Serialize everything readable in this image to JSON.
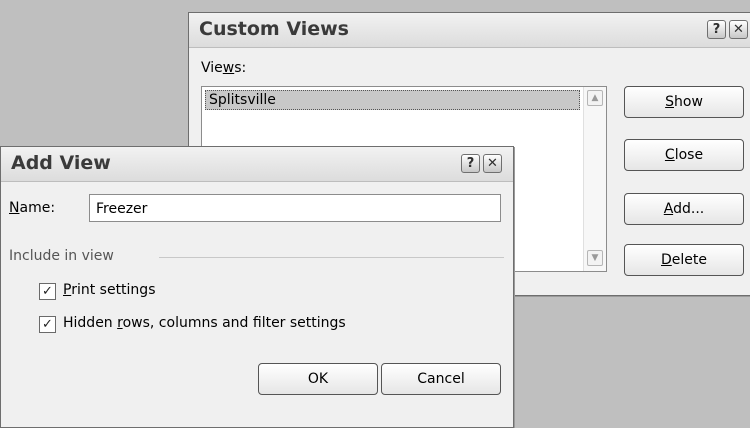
{
  "custom_views": {
    "title": "Custom Views",
    "views_label_pre": "Vie",
    "views_label_ul": "w",
    "views_label_post": "s:",
    "views": [
      "Splitsville"
    ],
    "buttons": {
      "show": {
        "ul": "S",
        "rest": "how"
      },
      "close": {
        "ul": "C",
        "rest": "lose"
      },
      "add": {
        "ul": "A",
        "rest": "dd..."
      },
      "delete": {
        "ul": "D",
        "rest": "elete"
      }
    },
    "help_glyph": "?",
    "close_glyph": "✕"
  },
  "add_view": {
    "title": "Add View",
    "name_label_ul": "N",
    "name_label_rest": "ame:",
    "name_value": "Freezer",
    "group_label": "Include in view",
    "options": [
      {
        "pre": "",
        "ul": "P",
        "post": "rint settings",
        "checked": true
      },
      {
        "pre": "Hidden ",
        "ul": "r",
        "post": "ows, columns and filter settings",
        "checked": true
      }
    ],
    "ok_label": "OK",
    "cancel_label": "Cancel",
    "help_glyph": "?",
    "close_glyph": "✕",
    "check_glyph": "✓"
  },
  "icons": {
    "scroll_up": "▲",
    "scroll_down": "▼"
  }
}
